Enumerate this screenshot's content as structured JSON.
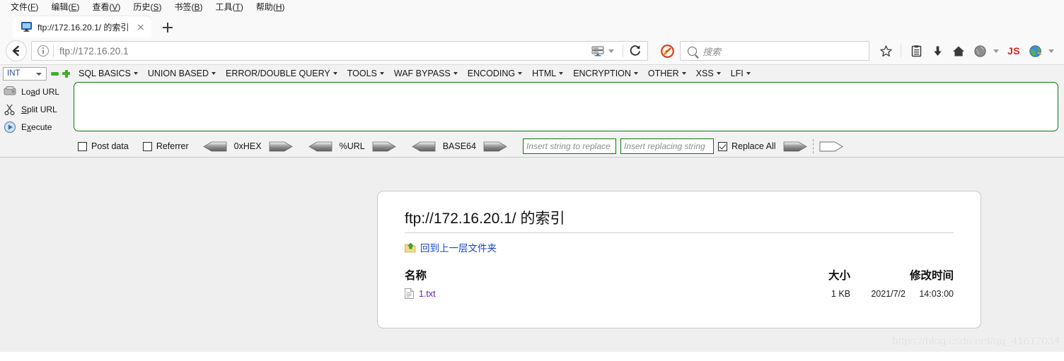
{
  "menubar": {
    "items": [
      {
        "label": "文件",
        "accel": "F"
      },
      {
        "label": "编辑",
        "accel": "E"
      },
      {
        "label": "查看",
        "accel": "V"
      },
      {
        "label": "历史",
        "accel": "S"
      },
      {
        "label": "书签",
        "accel": "B"
      },
      {
        "label": "工具",
        "accel": "T"
      },
      {
        "label": "帮助",
        "accel": "H"
      }
    ]
  },
  "tabstrip": {
    "tab_title": "ftp://172.16.20.1/ 的索引",
    "favicon": "computer-icon",
    "close_label": "关闭",
    "newtab_label": "新建标签页"
  },
  "navbar": {
    "back_icon": "back-arrow-icon",
    "info_icon": "info-icon",
    "url_value": "ftp://172.16.20.1",
    "server_icon": "server-icon",
    "reload_icon": "reload-icon",
    "noscript_icon": "noscript-blocked-icon",
    "search_placeholder": "搜索",
    "search_icon": "magnifier-icon",
    "bookmark_icon": "star-icon",
    "library_icon": "library-icon",
    "download_icon": "download-arrow-icon",
    "home_icon": "home-icon",
    "account_icon": "account-globe-icon",
    "js_label": "JS",
    "addon_icon": "globe-addon-icon"
  },
  "hackbar": {
    "select_value": "INT",
    "remove_icon": "minus-icon",
    "add_icon": "plus-icon",
    "actions": [
      {
        "label": "Load URL",
        "accel": "d",
        "icon": "load-url-icon"
      },
      {
        "label": "Split URL",
        "accel": "S",
        "icon": "split-url-icon"
      },
      {
        "label": "Execute",
        "accel": "x",
        "icon": "execute-icon"
      }
    ],
    "menus": [
      "SQL BASICS",
      "UNION BASED",
      "ERROR/DOUBLE QUERY",
      "TOOLS",
      "WAF BYPASS",
      "ENCODING",
      "HTML",
      "ENCRYPTION",
      "OTHER",
      "XSS",
      "LFI"
    ],
    "textarea_value": "",
    "post_data_label": "Post data",
    "post_data_checked": false,
    "referrer_label": "Referrer",
    "referrer_checked": false,
    "converters": [
      "0xHEX",
      "%URL",
      "BASE64"
    ],
    "replace_search_placeholder": "Insert string to replace",
    "replace_with_placeholder": "Insert replacing string",
    "replace_all_label": "Replace All",
    "replace_all_checked": true,
    "accent_green": "#0a7a0a"
  },
  "page": {
    "title": "ftp://172.16.20.1/ 的索引",
    "up_link": "回到上一层文件夹",
    "up_icon": "folder-up-icon",
    "columns": {
      "name": "名称",
      "size": "大小",
      "modified": "修改时间"
    },
    "rows": [
      {
        "icon": "text-file-icon",
        "name": "1.txt",
        "size": "1 KB",
        "date": "2021/7/2",
        "time": "14:03:00"
      }
    ],
    "watermark": "https://blog.csdn.net/qq_41617034"
  }
}
